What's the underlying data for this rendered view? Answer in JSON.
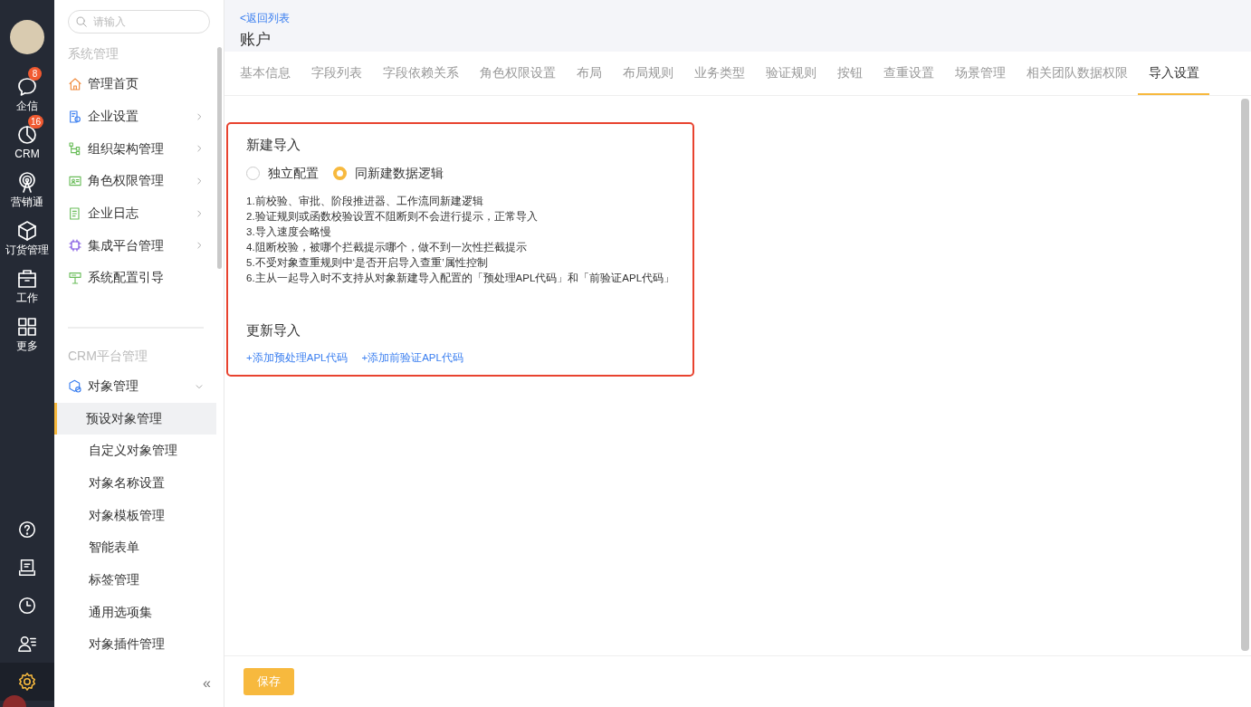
{
  "rail": {
    "badges_items": [
      {
        "label": "企信",
        "badge": "8"
      },
      {
        "label": "CRM",
        "badge": "16"
      },
      {
        "label": "营销通"
      },
      {
        "label": "订货管理"
      },
      {
        "label": "工作"
      },
      {
        "label": "更多"
      }
    ],
    "bottom_items": [
      {
        "selected": false
      },
      {
        "selected": false
      },
      {
        "selected": false
      },
      {
        "selected": false
      },
      {
        "selected": true
      }
    ]
  },
  "sidebar": {
    "search": {
      "placeholder": "请输入"
    },
    "sections": [
      {
        "title": "系统管理",
        "items": [
          {
            "label": "管理首页"
          },
          {
            "label": "企业设置",
            "expanded": false
          },
          {
            "label": "组织架构管理",
            "expanded": false
          },
          {
            "label": "角色权限管理",
            "expanded": false
          },
          {
            "label": "企业日志",
            "expanded": false
          },
          {
            "label": "集成平台管理",
            "expanded": false
          },
          {
            "label": "系统配置引导"
          }
        ]
      },
      {
        "title": "CRM平台管理",
        "items": [
          {
            "label": "对象管理",
            "expanded": true,
            "children": [
              {
                "label": "预设对象管理",
                "selected": true
              },
              {
                "label": "自定义对象管理",
                "selected": false
              },
              {
                "label": "对象名称设置",
                "selected": false
              },
              {
                "label": "对象模板管理",
                "selected": false
              },
              {
                "label": "智能表单",
                "selected": false
              },
              {
                "label": "标签管理",
                "selected": false
              },
              {
                "label": "通用选项集",
                "selected": false
              },
              {
                "label": "对象插件管理",
                "selected": false
              }
            ]
          }
        ]
      }
    ],
    "collapse": "«"
  },
  "header": {
    "back_link": "<返回列表",
    "title": "账户"
  },
  "tabs": [
    {
      "label": "基本信息",
      "selected": false
    },
    {
      "label": "字段列表",
      "selected": false
    },
    {
      "label": "字段依赖关系",
      "selected": false
    },
    {
      "label": "角色权限设置",
      "selected": false
    },
    {
      "label": "布局",
      "selected": false
    },
    {
      "label": "布局规则",
      "selected": false
    },
    {
      "label": "业务类型",
      "selected": false
    },
    {
      "label": "验证规则",
      "selected": false
    },
    {
      "label": "按钮",
      "selected": false
    },
    {
      "label": "查重设置",
      "selected": false
    },
    {
      "label": "场景管理",
      "selected": false
    },
    {
      "label": "相关团队数据权限",
      "selected": false
    },
    {
      "label": "导入设置",
      "selected": true
    }
  ],
  "new_import": {
    "title": "新建导入",
    "options": [
      {
        "label": "独立配置",
        "selected": false
      },
      {
        "label": "同新建数据逻辑",
        "selected": true
      }
    ],
    "notes": [
      "1.前校验、审批、阶段推进器、工作流同新建逻辑",
      "2.验证规则或函数校验设置不阻断则不会进行提示，正常导入",
      "3.导入速度会略慢",
      "4.阻断校验，被哪个拦截提示哪个，做不到一次性拦截提示",
      "5.不受对象查重规则中‘是否开启导入查重’属性控制",
      "6.主从一起导入时不支持从对象新建导入配置的「预处理APL代码」和「前验证APL代码」"
    ]
  },
  "update_import": {
    "title": "更新导入",
    "links": [
      "+添加预处理APL代码",
      "+添加前验证APL代码"
    ]
  },
  "save_button": "保存"
}
